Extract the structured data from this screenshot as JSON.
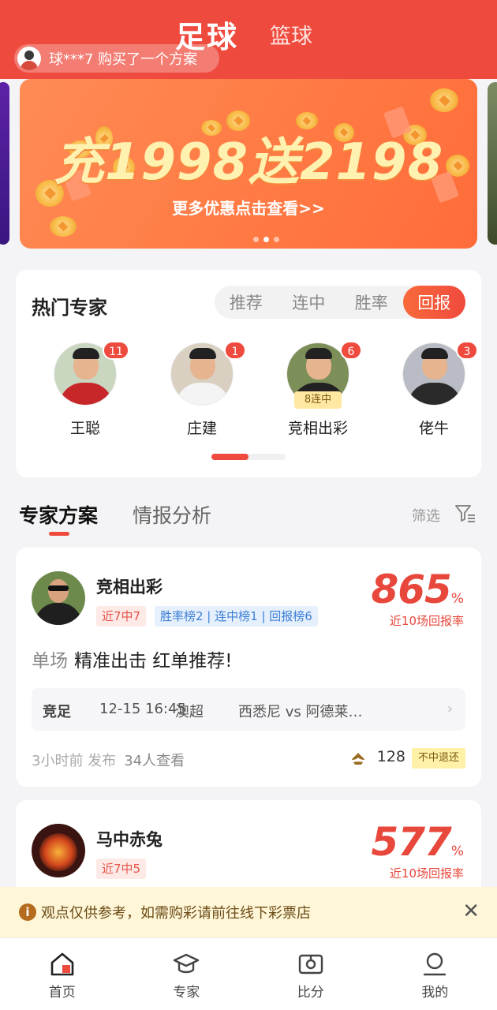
{
  "header": {
    "tab_active": "足球",
    "tab_other": "篮球",
    "ticker": "球***7 购买了一个方案"
  },
  "banner": {
    "title": "充1998送2198",
    "subtitle": "更多优惠点击查看>>"
  },
  "hot_experts": {
    "title": "热门专家",
    "segments": [
      "推荐",
      "连中",
      "胜率",
      "回报"
    ],
    "active_segment": "回报",
    "experts": [
      {
        "name": "王聪",
        "badge": "11"
      },
      {
        "name": "庄建",
        "badge": "1"
      },
      {
        "name": "竞相出彩",
        "badge": "6",
        "streak": "8连中"
      },
      {
        "name": "佬牛",
        "badge": "3"
      }
    ]
  },
  "section_tabs": {
    "active": "专家方案",
    "other": "情报分析",
    "filter": "筛选"
  },
  "schemes": [
    {
      "name": "竞相出彩",
      "tag_red": "近7中7",
      "tag_blue": "胜率榜2 | 连中榜1 | 回报榜6",
      "rate_value": "865",
      "rate_unit": "%",
      "rate_label": "近10场回报率",
      "type": "单场",
      "headline": "精准出击 红单推荐!",
      "match": {
        "league_type": "竞足",
        "time": "12-15 16:45",
        "league": "澳超",
        "teams": "西悉尼 vs 阿德莱…"
      },
      "published": "3小时前 发布",
      "views": "34人查看",
      "price": "128",
      "refund": "不中退还"
    },
    {
      "name": "马中赤兔",
      "tag_red": "近7中5",
      "rate_value": "577",
      "rate_unit": "%",
      "rate_label": "近10场回报率"
    }
  ],
  "notice": {
    "text": "观点仅供参考，如需购彩请前往线下彩票店"
  },
  "nav": [
    {
      "label": "首页",
      "icon": "home-icon"
    },
    {
      "label": "专家",
      "icon": "graduation-cap-icon"
    },
    {
      "label": "比分",
      "icon": "scoreboard-icon"
    },
    {
      "label": "我的",
      "icon": "user-icon"
    }
  ],
  "colors": {
    "brand": "#ef4a3e",
    "accent_orange": "#ff7a44",
    "notice_bg": "#fff6d8"
  }
}
